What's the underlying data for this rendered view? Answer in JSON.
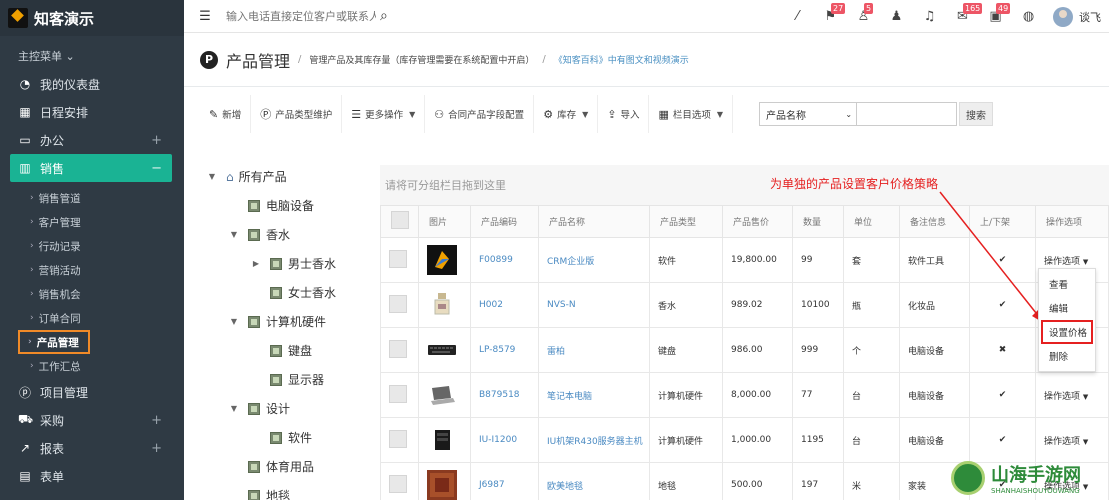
{
  "app": {
    "name": "知客演示"
  },
  "sidebar": {
    "main_menu": "主控菜单",
    "items": [
      {
        "label": "我的仪表盘",
        "icon": "dashboard-icon"
      },
      {
        "label": "日程安排",
        "icon": "calendar-icon"
      },
      {
        "label": "办公",
        "icon": "monitor-icon"
      },
      {
        "label": "销售",
        "icon": "chart-icon"
      }
    ],
    "sub_items": [
      "销售管道",
      "客户管理",
      "行动记录",
      "营销活动",
      "销售机会",
      "订单合同",
      "产品管理",
      "工作汇总"
    ],
    "items2": [
      {
        "label": "项目管理",
        "icon": "project-icon"
      },
      {
        "label": "采购",
        "icon": "truck-icon"
      },
      {
        "label": "报表",
        "icon": "report-icon"
      },
      {
        "label": "表单",
        "icon": "form-icon"
      }
    ]
  },
  "topbar": {
    "search_placeholder": "输入电话直接定位客户或联系人",
    "badges": [
      "27",
      "5",
      "165",
      "49"
    ],
    "username": "谈飞"
  },
  "header": {
    "title": "产品管理",
    "desc": "管理产品及其库存量（库存管理需要在系统配置中开启）",
    "link": "《知客百科》中有图文和视频演示"
  },
  "toolbar": {
    "add": "新增",
    "type_maintain": "产品类型维护",
    "more": "更多操作",
    "contract_fields": "合同产品字段配置",
    "stock": "库存",
    "import": "导入",
    "columns": "栏目选项",
    "filter_select": "产品名称",
    "search": "搜索"
  },
  "tree": {
    "root": "所有产品",
    "nodes": [
      "电脑设备",
      "香水",
      "男士香水",
      "女士香水",
      "计算机硬件",
      "键盘",
      "显示器",
      "设计",
      "软件",
      "体育用品",
      "地毯"
    ]
  },
  "grid": {
    "group_hint": "请将可分组栏目拖到这里",
    "annotation": "为单独的产品设置客户价格策略",
    "headers": [
      "图片",
      "产品编码",
      "产品名称",
      "产品类型",
      "产品售价",
      "数量",
      "单位",
      "备注信息",
      "上/下架",
      "操作选项"
    ],
    "rows": [
      {
        "code": "F00899",
        "name": "CRM企业版",
        "type": "软件",
        "price": "19,800.00",
        "qty": "99",
        "unit": "套",
        "note": "软件工具",
        "status": "✔",
        "ops": "操作选项"
      },
      {
        "code": "H002",
        "name": "NVS-N",
        "type": "香水",
        "price": "989.02",
        "qty": "10100",
        "unit": "瓶",
        "note": "化妆品",
        "status": "✔",
        "ops": ""
      },
      {
        "code": "LP-8579",
        "name": "雷柏",
        "type": "键盘",
        "price": "986.00",
        "qty": "999",
        "unit": "个",
        "note": "电脑设备",
        "status": "✖",
        "ops": ""
      },
      {
        "code": "B879518",
        "name": "笔记本电脑",
        "type": "计算机硬件",
        "price": "8,000.00",
        "qty": "77",
        "unit": "台",
        "note": "电脑设备",
        "status": "✔",
        "ops": "操作选项"
      },
      {
        "code": "IU-I1200",
        "name": "IU机架R430服务器主机",
        "type": "计算机硬件",
        "price": "1,000.00",
        "qty": "1195",
        "unit": "台",
        "note": "电脑设备",
        "status": "✔",
        "ops": "操作选项"
      },
      {
        "code": "J6987",
        "name": "欧美地毯",
        "type": "地毯",
        "price": "500.00",
        "qty": "197",
        "unit": "米",
        "note": "家装",
        "status": "✔",
        "ops": "操作选项"
      }
    ],
    "dropdown": [
      "查看",
      "编辑",
      "设置价格",
      "删除"
    ]
  },
  "watermark": {
    "cn": "山海手游网",
    "en": "SHANHAISHOUYOUWANG"
  }
}
